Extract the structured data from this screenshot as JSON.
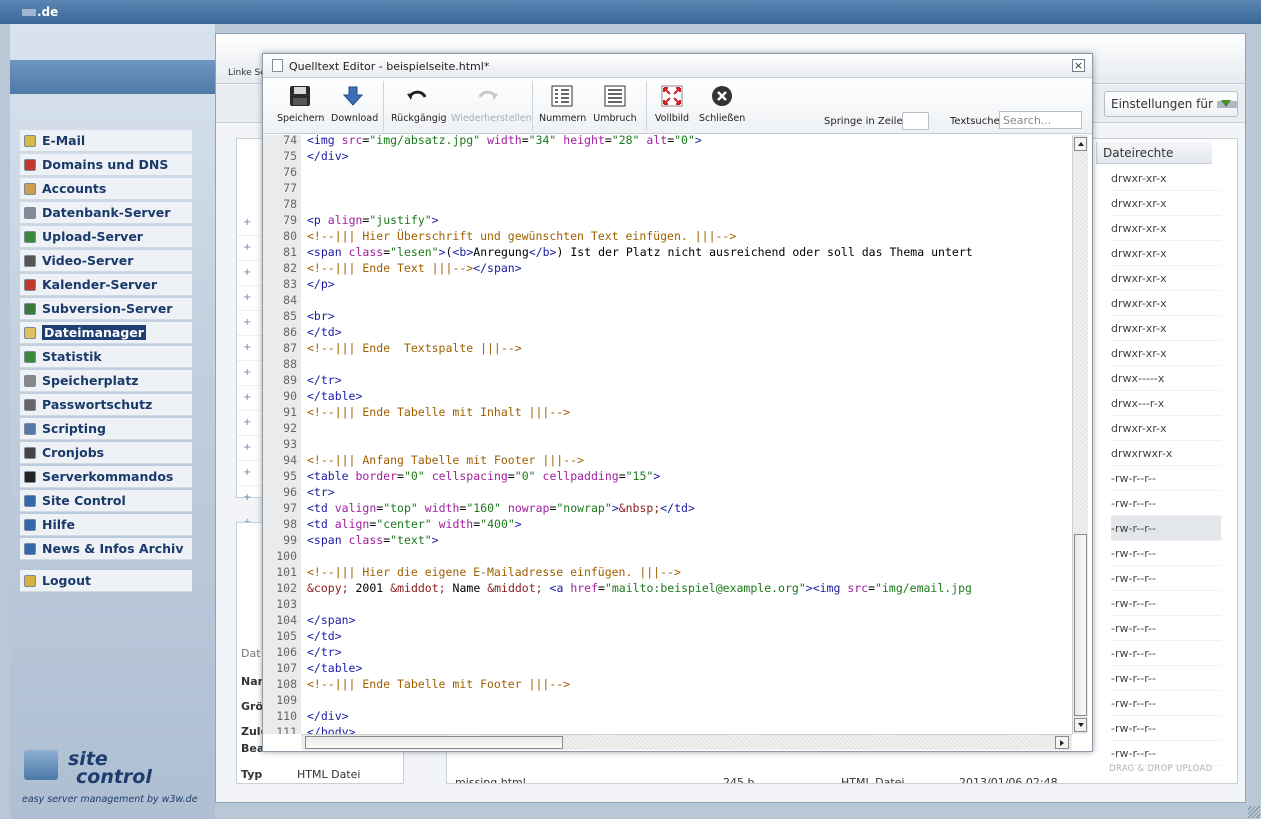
{
  "topbar": {
    "domain_suffix": ".de"
  },
  "nav": {
    "items": [
      {
        "label": "E-Mail",
        "color": "#d9b84a"
      },
      {
        "label": "Domains und DNS",
        "color": "#c0392b"
      },
      {
        "label": "Accounts",
        "color": "#c8a050"
      },
      {
        "label": "Datenbank-Server",
        "color": "#7f8c99"
      },
      {
        "label": "Upload-Server",
        "color": "#3a8a3a"
      },
      {
        "label": "Video-Server",
        "color": "#555555"
      },
      {
        "label": "Kalender-Server",
        "color": "#c0392b"
      },
      {
        "label": "Subversion-Server",
        "color": "#3a7a3a"
      },
      {
        "label": "Dateimanager",
        "color": "#e0c060",
        "active": true
      },
      {
        "label": "Statistik",
        "color": "#3a8a3a"
      },
      {
        "label": "Speicherplatz",
        "color": "#888888"
      },
      {
        "label": "Passwortschutz",
        "color": "#666666"
      },
      {
        "label": "Scripting",
        "color": "#5577aa"
      },
      {
        "label": "Cronjobs",
        "color": "#444444"
      },
      {
        "label": "Serverkommandos",
        "color": "#222222"
      },
      {
        "label": "Site Control",
        "color": "#3366aa"
      },
      {
        "label": "Hilfe",
        "color": "#3366aa"
      },
      {
        "label": "News & Infos Archiv",
        "color": "#3366aa"
      }
    ],
    "logout": "Logout"
  },
  "brand": {
    "line1": "site",
    "line2": "control",
    "tagline": "easy server management by w3w.de"
  },
  "filemanager": {
    "toolbar_left_label": "Linke Se",
    "settings_label": "Einstellungen für",
    "column_header": "Dateirechte",
    "permissions": [
      "drwxr-xr-x",
      "drwxr-xr-x",
      "drwxr-xr-x",
      "drwxr-xr-x",
      "drwxr-xr-x",
      "drwxr-xr-x",
      "drwxr-xr-x",
      "drwxr-xr-x",
      "drwx-----x",
      "drwx---r-x",
      "drwxr-xr-x",
      "drwxrwxr-x",
      "-rw-r--r--",
      "-rw-r--r--",
      "-rw-r--r--",
      "-rw-r--r--",
      "-rw-r--r--",
      "-rw-r--r--",
      "-rw-r--r--",
      "-rw-r--r--",
      "-rw-r--r--",
      "-rw-r--r--",
      "-rw-r--r--",
      "-rw-r--r--"
    ],
    "selected_perm_index": 14,
    "bottom_file": {
      "name": "missing.html",
      "size": "245 b",
      "type": "HTML Datei",
      "date": "2013/01/06 02:48"
    },
    "drag_drop": "DRAG & DROP UPLOAD",
    "info": {
      "header": "Dat",
      "name_label": "Nam",
      "size_label": "Grö",
      "modified_label": "Zule",
      "edit_label": "Bea",
      "type_label": "Typ",
      "type_value": "HTML Datei"
    }
  },
  "editor": {
    "title": "Quelltext Editor - beispielseite.html*",
    "close": "×",
    "toolbar": {
      "save": "Speichern",
      "download": "Download",
      "undo": "Rückgängig",
      "redo": "Wiederherstellen",
      "numbers": "Nummern",
      "wrap": "Umbruch",
      "fullscreen": "Vollbild",
      "close": "Schließen"
    },
    "goto_label": "Springe in Zeile",
    "goto_value": "",
    "search_label": "Textsuche",
    "search_placeholder": "Search...",
    "lines": [
      {
        "n": "74",
        "t": "<img src=\"img/absatz.jpg\" width=\"34\" height=\"28\" alt=\"0\">"
      },
      {
        "n": "75",
        "t": "</div>"
      },
      {
        "n": "76",
        "t": ""
      },
      {
        "n": "77",
        "t": ""
      },
      {
        "n": "78",
        "t": ""
      },
      {
        "n": "79",
        "t": "<p align=\"justify\">"
      },
      {
        "n": "80",
        "t": "<!--||| Hier Überschrift und gewünschten Text einfügen. |||-->"
      },
      {
        "n": "81",
        "t": "<span class=\"lesen\">(<b>Anregung</b>) Ist der Platz nicht ausreichend oder soll das Thema untert"
      },
      {
        "n": "82",
        "t": "<!--||| Ende Text |||--></span>"
      },
      {
        "n": "83",
        "t": "</p>"
      },
      {
        "n": "84",
        "t": ""
      },
      {
        "n": "85",
        "t": "<br>"
      },
      {
        "n": "86",
        "t": "</td>"
      },
      {
        "n": "87",
        "t": "<!--||| Ende  Textspalte |||-->"
      },
      {
        "n": "88",
        "t": ""
      },
      {
        "n": "89",
        "t": "</tr>"
      },
      {
        "n": "90",
        "t": "</table>"
      },
      {
        "n": "91",
        "t": "<!--||| Ende Tabelle mit Inhalt |||-->"
      },
      {
        "n": "92",
        "t": ""
      },
      {
        "n": "93",
        "t": ""
      },
      {
        "n": "94",
        "t": "<!--||| Anfang Tabelle mit Footer |||-->"
      },
      {
        "n": "95",
        "t": "<table border=\"0\" cellspacing=\"0\" cellpadding=\"15\">"
      },
      {
        "n": "96",
        "t": "<tr>"
      },
      {
        "n": "97",
        "t": "<td valign=\"top\" width=\"160\" nowrap=\"nowrap\">&nbsp;</td>"
      },
      {
        "n": "98",
        "t": "<td align=\"center\" width=\"400\">"
      },
      {
        "n": "99",
        "t": "<span class=\"text\">"
      },
      {
        "n": "100",
        "t": ""
      },
      {
        "n": "101",
        "t": "<!--||| Hier die eigene E-Mailadresse einfügen. |||-->"
      },
      {
        "n": "102",
        "t": "&copy; 2001 &middot; Name &middot; <a href=\"mailto:beispiel@example.org\"><img src=\"img/email.jpg"
      },
      {
        "n": "103",
        "t": ""
      },
      {
        "n": "104",
        "t": "</span>"
      },
      {
        "n": "105",
        "t": "</td>"
      },
      {
        "n": "106",
        "t": "</tr>"
      },
      {
        "n": "107",
        "t": "</table>"
      },
      {
        "n": "108",
        "t": "<!--||| Ende Tabelle mit Footer |||-->"
      },
      {
        "n": "109",
        "t": ""
      },
      {
        "n": "110",
        "t": "</div>"
      },
      {
        "n": "111",
        "t": "</body>"
      },
      {
        "n": "112",
        "t": ""
      }
    ]
  },
  "colors": {
    "accent": "#3a6796",
    "nav_text": "#1a3a6a"
  }
}
